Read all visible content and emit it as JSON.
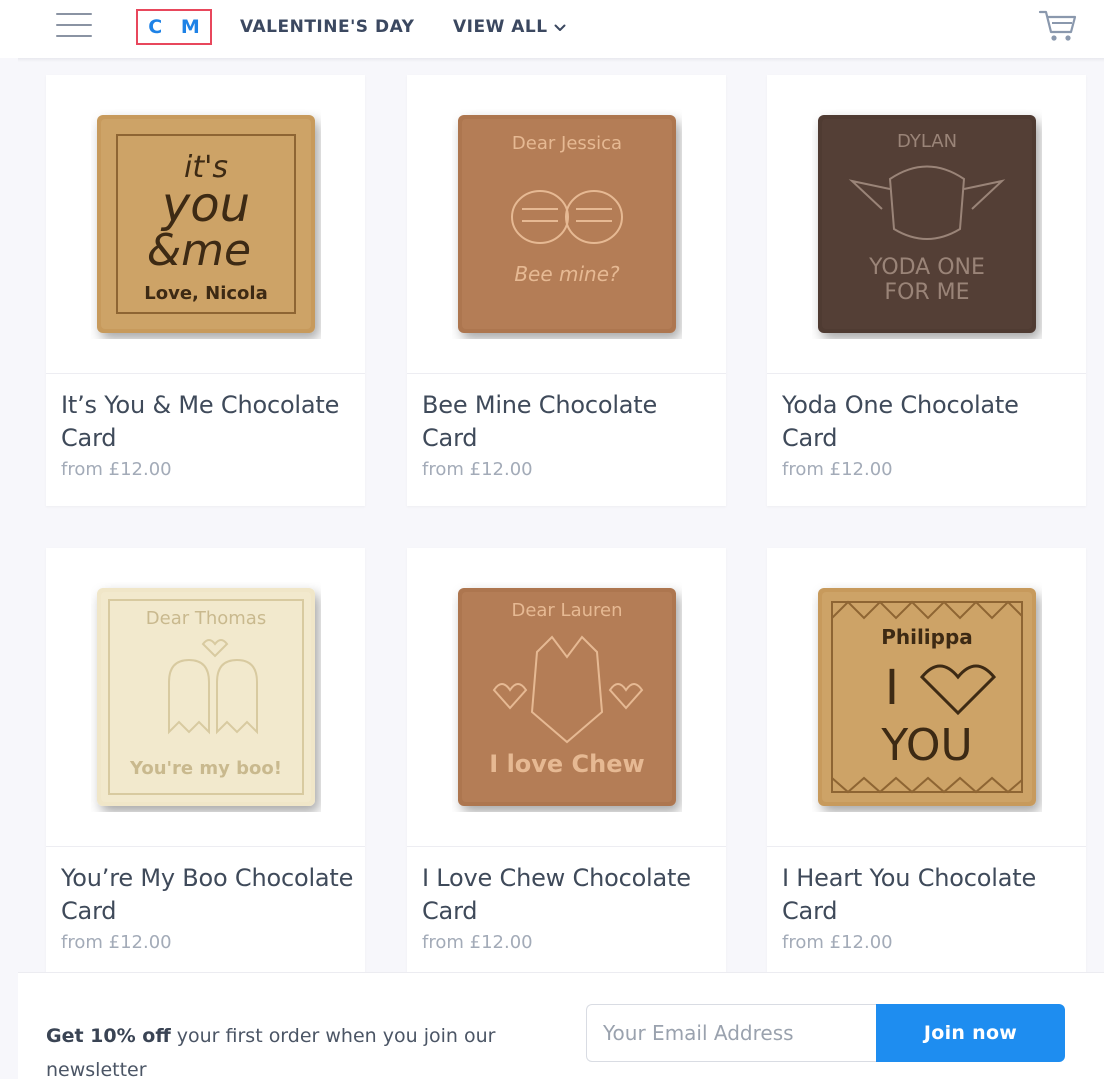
{
  "header": {
    "logo": "C M",
    "nav_valentine": "VALENTINE'S DAY",
    "nav_view_all": "VIEW ALL",
    "icons": [
      "hamburger-menu-icon",
      "chevron-down-icon",
      "shopping-cart-icon"
    ]
  },
  "products": [
    {
      "title": "It’s You & Me Chocolate Card",
      "price": "from £12.00",
      "image": {
        "chocolate": "golden",
        "lines": [
          "it's",
          "you",
          "&me",
          "Love, Nicola"
        ]
      }
    },
    {
      "title": "Bee Mine Chocolate Card",
      "price": "from £12.00",
      "image": {
        "chocolate": "milk",
        "lines": [
          "Dear Jessica",
          "Bee mine?"
        ]
      }
    },
    {
      "title": "Yoda One Chocolate Card",
      "price": "from £12.00",
      "image": {
        "chocolate": "dark",
        "lines": [
          "DYLAN",
          "YODA ONE",
          "FOR ME"
        ]
      }
    },
    {
      "title": "You’re My Boo Chocolate Card",
      "price": "from £12.00",
      "image": {
        "chocolate": "white",
        "lines": [
          "Dear Thomas",
          "You're my boo!"
        ]
      }
    },
    {
      "title": "I Love Chew Chocolate Card",
      "price": "from £12.00",
      "image": {
        "chocolate": "milk",
        "lines": [
          "Dear Lauren",
          "I love Chew"
        ]
      }
    },
    {
      "title": "I Heart You Chocolate Card",
      "price": "from £12.00",
      "image": {
        "chocolate": "golden",
        "lines": [
          "Philippa",
          "I",
          "YOU"
        ]
      }
    }
  ],
  "newsletter": {
    "bold": "Get 10% off",
    "text": " your first order when you join our newsletter",
    "placeholder": "Your Email Address",
    "button": "Join now"
  },
  "colors": {
    "accent_blue": "#1e8df0",
    "logo_blue": "#1e82e6",
    "logo_border": "#e8475c",
    "text": "#3f4a5a",
    "muted": "#a3abb8",
    "golden_chocolate": "#c79a5c",
    "milk_chocolate": "#ad7650",
    "dark_chocolate": "#4f3a33",
    "white_chocolate": "#f0e6c8"
  }
}
